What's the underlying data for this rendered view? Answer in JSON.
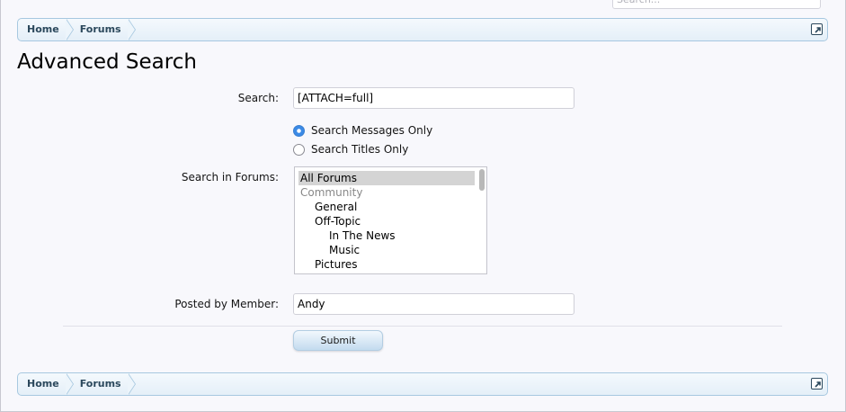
{
  "header": {
    "search_placeholder": "Search..."
  },
  "breadcrumb": {
    "items": [
      "Home",
      "Forums"
    ]
  },
  "page": {
    "title": "Advanced Search"
  },
  "form": {
    "search_label": "Search:",
    "search_value": "[ATTACH=full]",
    "radio_options": [
      {
        "label": "Search Messages Only",
        "checked": true
      },
      {
        "label": "Search Titles Only",
        "checked": false
      }
    ],
    "forums_label": "Search in Forums:",
    "forums": [
      {
        "label": "All Forums",
        "selected": true,
        "group": false,
        "depth": 0
      },
      {
        "label": "Community",
        "selected": false,
        "group": true,
        "depth": 0
      },
      {
        "label": "General",
        "selected": false,
        "group": false,
        "depth": 1
      },
      {
        "label": "Off-Topic",
        "selected": false,
        "group": false,
        "depth": 1
      },
      {
        "label": "In The News",
        "selected": false,
        "group": false,
        "depth": 2
      },
      {
        "label": "Music",
        "selected": false,
        "group": false,
        "depth": 2
      },
      {
        "label": "Pictures",
        "selected": false,
        "group": false,
        "depth": 1
      }
    ],
    "member_label": "Posted by Member:",
    "member_value": "Andy",
    "submit_label": "Submit"
  },
  "icons": {
    "jump": "external-jump-icon",
    "radio": "radio-icon"
  },
  "colors": {
    "accent": "#3b8ae6",
    "breadcrumb_border": "#a7c8e0",
    "crumb_text": "#2b485c"
  }
}
